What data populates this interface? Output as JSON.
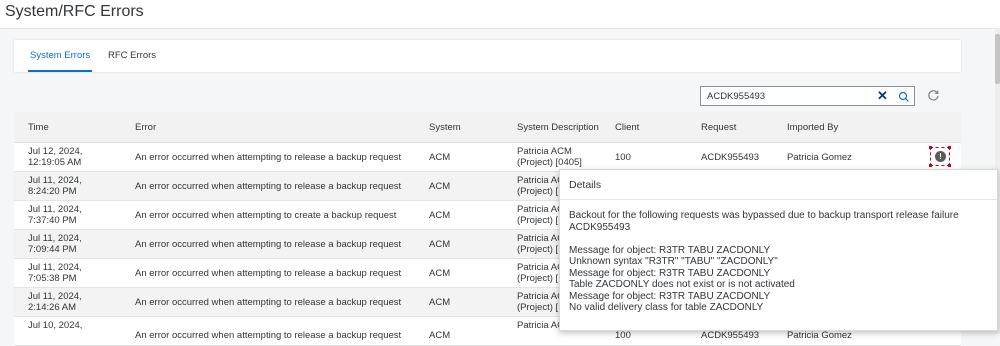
{
  "page": {
    "title": "System/RFC Errors"
  },
  "tabs": [
    {
      "label": "System Errors",
      "active": true
    },
    {
      "label": "RFC Errors",
      "active": false
    }
  ],
  "search": {
    "value": "ACDK955493",
    "placeholder": ""
  },
  "icons": {
    "clear": "close-icon",
    "search": "search-icon",
    "refresh": "refresh-icon",
    "info": "info-icon"
  },
  "colors": {
    "accent": "#0a6ed1",
    "info_outline": "#d0021b"
  },
  "table": {
    "columns": [
      "Time",
      "Error",
      "System",
      "System Description",
      "Client",
      "Request",
      "Imported By"
    ],
    "rows": [
      {
        "time_line1": "Jul 12, 2024,",
        "time_line2": "12:19:05 AM",
        "error": "An error occurred when attempting to release a backup request",
        "system": "ACM",
        "desc_line1": "Patricia ACM",
        "desc_line2": "(Project) [0405]",
        "client": "100",
        "request": "ACDK955493",
        "imported_by": "Patricia Gomez"
      },
      {
        "time_line1": "Jul 11, 2024,",
        "time_line2": "8:24:20 PM",
        "error": "An error occurred when attempting to release a backup request",
        "system": "ACM",
        "desc_line1": "Patricia AC",
        "desc_line2": "(Project) [",
        "client": "",
        "request": "",
        "imported_by": ""
      },
      {
        "time_line1": "Jul 11, 2024,",
        "time_line2": "7:37:40 PM",
        "error": "An error occurred when attempting to create a backup request",
        "system": "ACM",
        "desc_line1": "Patricia AC",
        "desc_line2": "(Project) [",
        "client": "",
        "request": "",
        "imported_by": ""
      },
      {
        "time_line1": "Jul 11, 2024,",
        "time_line2": "7:09:44 PM",
        "error": "An error occurred when attempting to release a backup request",
        "system": "ACM",
        "desc_line1": "Patricia AC",
        "desc_line2": "(Project) [",
        "client": "",
        "request": "",
        "imported_by": ""
      },
      {
        "time_line1": "Jul 11, 2024,",
        "time_line2": "7:05:38 PM",
        "error": "An error occurred when attempting to release a backup request",
        "system": "ACM",
        "desc_line1": "Patricia AC",
        "desc_line2": "(Project) [",
        "client": "",
        "request": "",
        "imported_by": ""
      },
      {
        "time_line1": "Jul 11, 2024,",
        "time_line2": "2:14:26 AM",
        "error": "An error occurred when attempting to release a backup request",
        "system": "ACM",
        "desc_line1": "Patricia AC",
        "desc_line2": "(Project) [",
        "client": "",
        "request": "",
        "imported_by": ""
      },
      {
        "time_line1": "Jul 10, 2024,",
        "time_line2": "",
        "error": "An error occurred when attempting to release a backup request",
        "system": "ACM",
        "desc_line1": "Patricia AC",
        "desc_line2": "",
        "client": "100",
        "request": "ACDK955493",
        "imported_by": "Patricia Gomez"
      }
    ]
  },
  "details": {
    "title": "Details",
    "summary_line1": "Backout for the following requests was bypassed due to backup transport release failure",
    "summary_line2": "ACDK955493",
    "messages": [
      "Message for object: R3TR TABU ZACDONLY",
      "Unknown syntax \"R3TR\" \"TABU\" \"ZACDONLY\"",
      "Message for object: R3TR TABU ZACDONLY",
      "Table ZACDONLY does not exist or is not activated",
      "Message for object: R3TR TABU ZACDONLY",
      "No valid delivery class for table ZACDONLY"
    ]
  }
}
